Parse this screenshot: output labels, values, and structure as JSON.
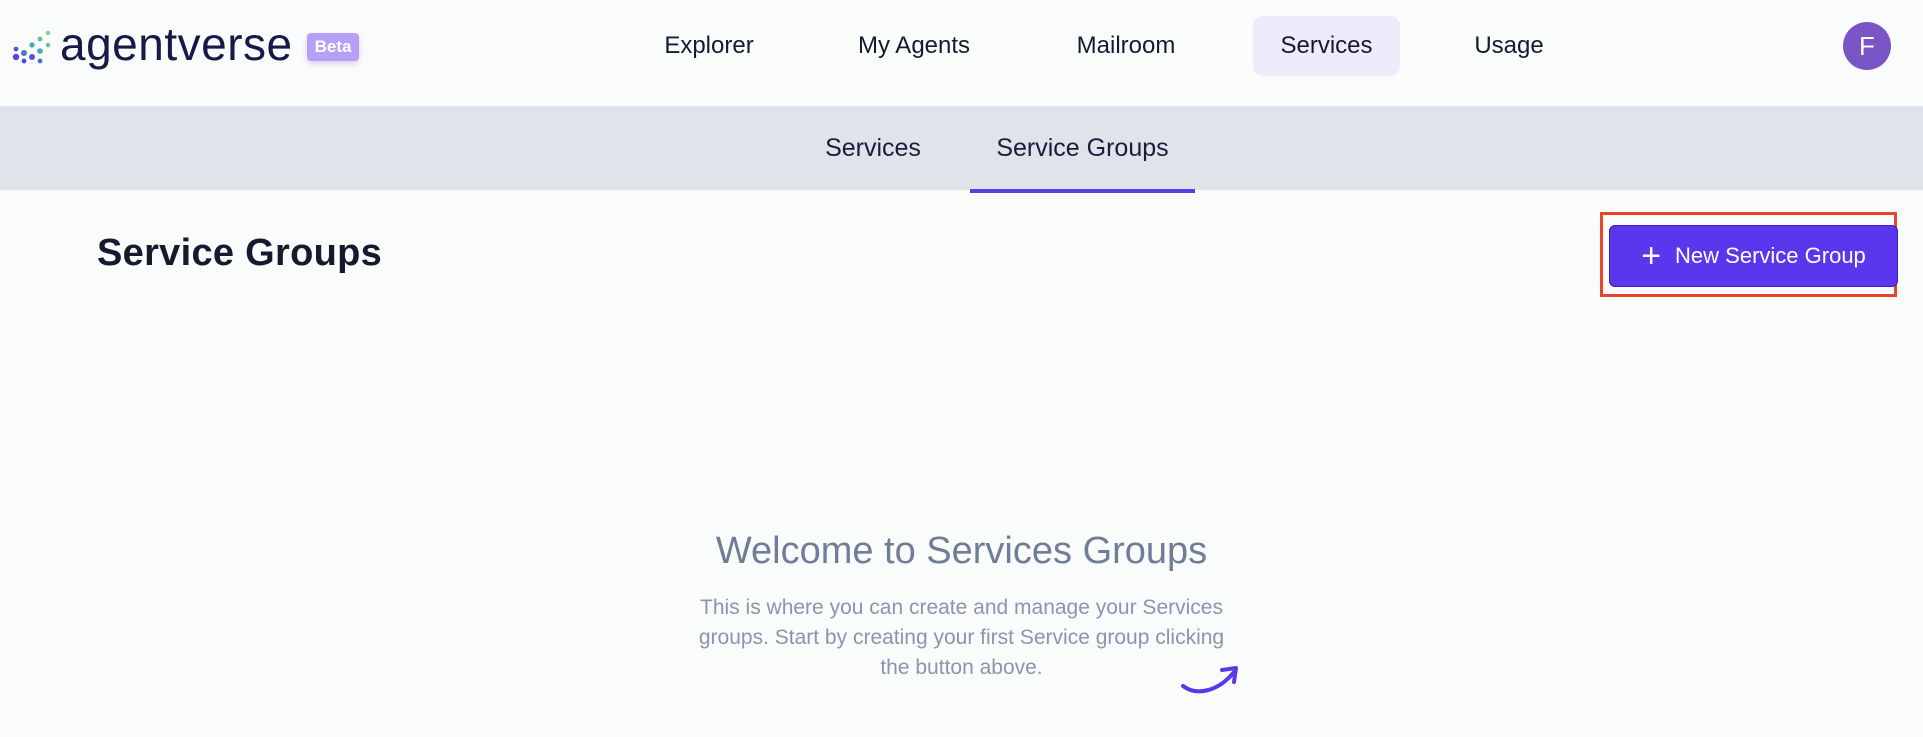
{
  "brand": {
    "name": "agentverse",
    "badge": "Beta"
  },
  "nav": {
    "items": [
      {
        "label": "Explorer",
        "active": false
      },
      {
        "label": "My Agents",
        "active": false
      },
      {
        "label": "Mailroom",
        "active": false
      },
      {
        "label": "Services",
        "active": true
      },
      {
        "label": "Usage",
        "active": false
      }
    ],
    "avatar_initial": "F"
  },
  "subnav": {
    "tabs": [
      {
        "label": "Services",
        "active": false
      },
      {
        "label": "Service Groups",
        "active": true
      }
    ]
  },
  "main": {
    "title": "Service Groups",
    "new_button_label": "New Service Group",
    "empty_state": {
      "title": "Welcome to Services Groups",
      "text": "This is where you can create and manage your Services groups. Start by creating your first Service group clicking the button above."
    }
  },
  "colors": {
    "accent": "#5a36ec",
    "highlight": "#e8442a",
    "avatar": "#7a55c6",
    "badge": "#b59ff7"
  }
}
